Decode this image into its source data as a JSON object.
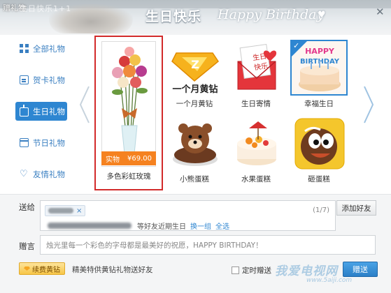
{
  "window": {
    "title": "赠礼物",
    "watermark": "生日快乐1+1"
  },
  "header": {
    "title": "生日快乐",
    "subtitle": "Happy Birthday"
  },
  "sidebar": {
    "items": [
      {
        "label": "全部礼物",
        "icon": "grid-icon",
        "active": false
      },
      {
        "label": "贺卡礼物",
        "icon": "card-icon",
        "active": false
      },
      {
        "label": "生日礼物",
        "icon": "cake-icon",
        "active": true
      },
      {
        "label": "节日礼物",
        "icon": "calendar-icon",
        "active": false
      },
      {
        "label": "友情礼物",
        "icon": "heart-icon",
        "active": false
      }
    ]
  },
  "gifts": {
    "featured": {
      "name": "多色彩虹玫瑰",
      "tag": "实物",
      "price": "¥69.00",
      "selected": true
    },
    "items": [
      {
        "name": "一个月黄钻",
        "caption": "一个月黄钻"
      },
      {
        "name": "生日寄情",
        "badge": "生日快乐"
      },
      {
        "name": "幸福生日",
        "checked": true,
        "banner": "HAPPY BIRTHDAY"
      },
      {
        "name": "小熊蛋糕"
      },
      {
        "name": "水果蛋糕"
      },
      {
        "name": "砸蛋糕"
      }
    ]
  },
  "form": {
    "to_label": "送给",
    "counter": "(1/7)",
    "add_friend": "添加好友",
    "suggest_text": "等好友近期生日",
    "suggest_refresh": "换一组",
    "suggest_all": "全选",
    "msg_label": "赠言",
    "msg_placeholder": "烛光里每一个彩色的字母都是最美好的祝愿，HAPPY BIRTHDAY！",
    "renew_button": "续费黄钻",
    "renew_text": "精美特供黄钻礼物送好友",
    "timer_label": "定时赠送",
    "send_button": "赠送",
    "watermark_text": "我爱电视网",
    "watermark_url": "www.5aiji.com"
  }
}
